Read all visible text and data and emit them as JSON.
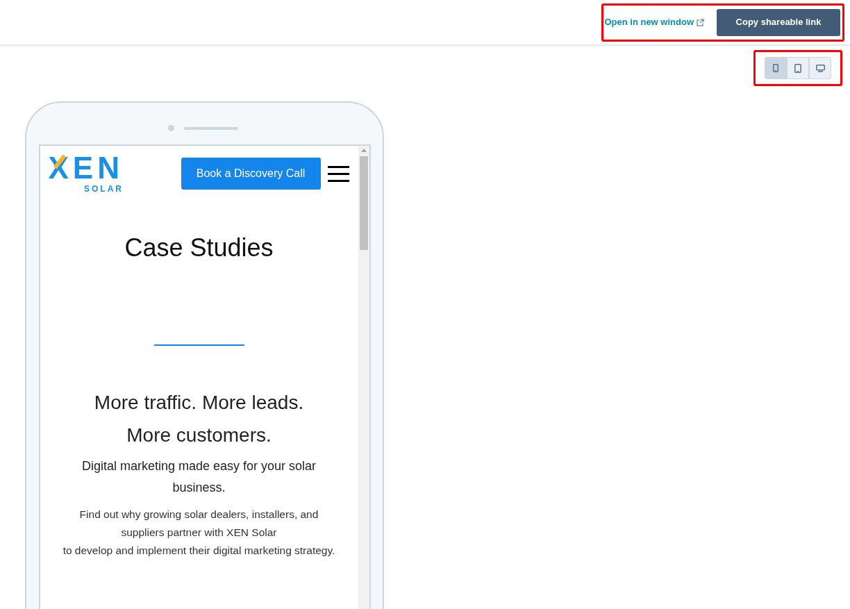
{
  "toolbar": {
    "open_link": "Open in new window",
    "copy_button": "Copy shareable link"
  },
  "device_toggle": [
    {
      "kind": "phone",
      "selected": true
    },
    {
      "kind": "tablet",
      "selected": false
    },
    {
      "kind": "desktop",
      "selected": false
    }
  ],
  "preview": {
    "logo": {
      "word": "XEN",
      "subword": "SOLAR"
    },
    "cta_button": "Book a Discovery Call",
    "title": "Case Studies",
    "headline_lines": [
      "More traffic. More leads.",
      "More customers."
    ],
    "subhead": "Digital marketing made easy for your solar business.",
    "body_lines": [
      "Find out why growing solar dealers, installers, and suppliers partner with XEN Solar",
      "to develop and implement their digital marketing strategy."
    ]
  }
}
